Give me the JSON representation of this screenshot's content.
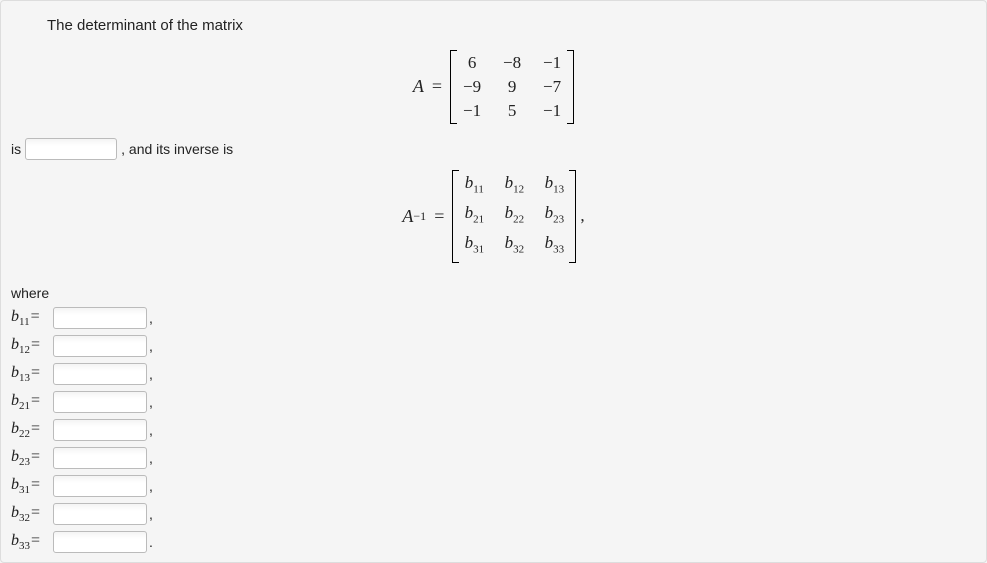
{
  "prompt": {
    "line1": "The determinant of the matrix",
    "is_word": "is",
    "and_inverse": ", and its inverse is",
    "where": "where"
  },
  "matrix_a": {
    "label_left": "A",
    "eq": "=",
    "rows": [
      [
        "6",
        "−8",
        "−1"
      ],
      [
        "−9",
        "9",
        "−7"
      ],
      [
        "−1",
        "5",
        "−1"
      ]
    ]
  },
  "matrix_ainv": {
    "label_left": "A",
    "sup": "−1",
    "eq": "=",
    "entries": [
      [
        "b",
        "11",
        "b",
        "12",
        "b",
        "13"
      ],
      [
        "b",
        "21",
        "b",
        "22",
        "b",
        "23"
      ],
      [
        "b",
        "31",
        "b",
        "32",
        "b",
        "33"
      ]
    ],
    "trail": ","
  },
  "fields": [
    {
      "var": "b",
      "sub": "11",
      "punct": ","
    },
    {
      "var": "b",
      "sub": "12",
      "punct": ","
    },
    {
      "var": "b",
      "sub": "13",
      "punct": ","
    },
    {
      "var": "b",
      "sub": "21",
      "punct": ","
    },
    {
      "var": "b",
      "sub": "22",
      "punct": ","
    },
    {
      "var": "b",
      "sub": "23",
      "punct": ","
    },
    {
      "var": "b",
      "sub": "31",
      "punct": ","
    },
    {
      "var": "b",
      "sub": "32",
      "punct": ","
    },
    {
      "var": "b",
      "sub": "33",
      "punct": "."
    }
  ]
}
